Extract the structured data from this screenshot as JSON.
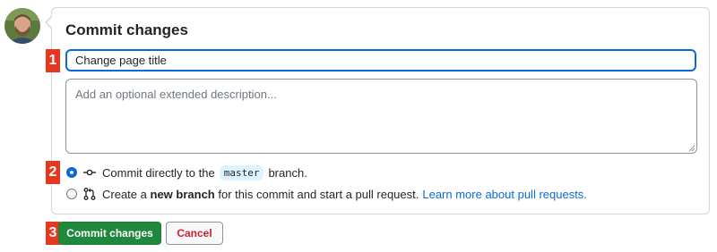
{
  "form": {
    "title": "Commit changes",
    "summary_value": "Change page title",
    "description_placeholder": "Add an optional extended description..."
  },
  "markers": [
    "1",
    "2",
    "3"
  ],
  "options": {
    "direct": {
      "prefix": "Commit directly to the",
      "branch": "master",
      "suffix": "branch.",
      "selected": true
    },
    "new_branch": {
      "prefix": "Create a",
      "bold": "new branch",
      "suffix": "for this commit and start a pull request.",
      "link": "Learn more about pull requests.",
      "selected": false
    }
  },
  "buttons": {
    "commit_label": "Commit changes",
    "cancel_label": "Cancel"
  },
  "colors": {
    "primary_button": "#1f883d",
    "cancel_text": "#cf222e",
    "link": "#0969da",
    "focus_border": "#0969da",
    "marker": "#e8361f"
  },
  "icons": {
    "direct": "git-commit-icon",
    "new_branch": "git-pull-request-icon"
  }
}
